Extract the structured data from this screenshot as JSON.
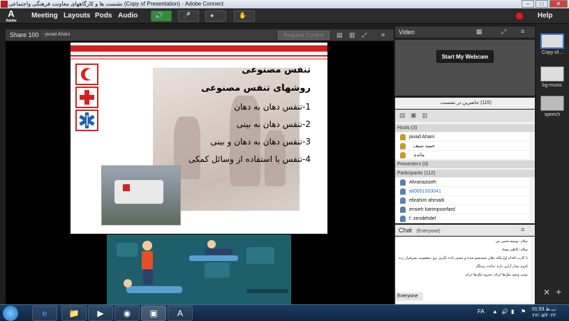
{
  "window": {
    "title": "نشست ها و کارگاههای معاونت فرهنگی واجتماعی (Copy of Presentation) - Adobe Connect",
    "min": "–",
    "max": "□",
    "close": "✕"
  },
  "menubar": {
    "logo": "A",
    "logo_sub": "Adobe",
    "items": [
      "Meeting",
      "Layouts",
      "Pods",
      "Audio"
    ],
    "help": "Help"
  },
  "share_pod": {
    "title": "Share 100",
    "presenter": "- javad Ahani",
    "request_control": "Request Control"
  },
  "slide": {
    "title": "تنفس مصنوعی",
    "subtitle": "روشهای تنفس مصنوعی",
    "items": [
      "1-تنفس دهان به دهان",
      "2-تنفس دهان به بینی",
      "3-تنفس دهان به دهان و بینی",
      "4-تنفس با استفاده از وسائل کمکی"
    ]
  },
  "video_pod": {
    "title": "Video",
    "webcam_button": "Start My Webcam"
  },
  "attendees_pod": {
    "title": "(115)  حاضرین در نشست",
    "hosts_label": "Hosts (3)",
    "hosts": [
      "javad Ahani",
      "حمید سیف الهی مقدم",
      "مائده رستگار"
    ],
    "presenters_label": "Presenters (0)",
    "participants_label": "Participants (112)",
    "participants": [
      "Ahrariazizeh",
      "ali0651003041",
      "ebrahim ahmadi",
      "ensieh karimpoorfard",
      "f. zendehdel"
    ]
  },
  "chat_pod": {
    "title": "Chat",
    "audience": "(Everyone)",
    "messages": [
      "سلام :یوسف‌حسن من",
      "سلام :کاظم پیشاد",
      "با کارت اقدام اول‌بلکه دهان شستشو شده و مسیر داده بگیری برو :معصومه پسرفراز زده",
      "کدوم بیمار آرایی داره :مائده رستگار",
      "نسب وجود ملل‌ها ابرام :بخروه ملل‌ها ابرام"
    ],
    "tab": "Everyone"
  },
  "layouts": [
    {
      "label": "Copy of..."
    },
    {
      "label": "bg-music"
    },
    {
      "label": "speech"
    }
  ],
  "taskbar": {
    "lang": "FA",
    "time": "01:53 ب.ظ",
    "date": "۲۶/۰۵/۲۰۲۲"
  },
  "colors": {
    "accent_red": "#d42020",
    "menu_bg": "#2c2c2c",
    "pod_header": "#3b3b3b",
    "webcam_bg": "#4d4d4d"
  }
}
